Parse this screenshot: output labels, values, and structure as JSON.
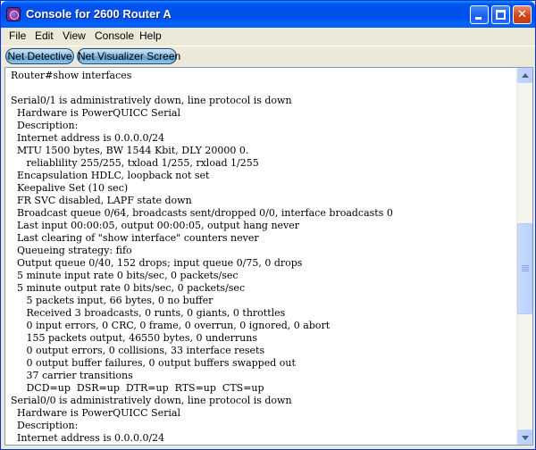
{
  "window": {
    "title": "Console for 2600 Router A",
    "buttons": {
      "minimize": "minimize",
      "maximize": "maximize",
      "close": "close"
    }
  },
  "menu": [
    "File",
    "Edit",
    "View",
    "Console",
    "Help"
  ],
  "toolbar": {
    "net_detective": "Net Detective",
    "net_visualizer": "Net Visualizer Screen"
  },
  "console": {
    "scroll_position": 0.55,
    "lines": [
      "Router#show interfaces",
      "",
      "Serial0/1 is administratively down, line protocol is down",
      "  Hardware is PowerQUICC Serial",
      "  Description:",
      "  Internet address is 0.0.0.0/24",
      "  MTU 1500 bytes, BW 1544 Kbit, DLY 20000 0.",
      "     reliablility 255/255, txload 1/255, rxload 1/255",
      "  Encapsulation HDLC, loopback not set",
      "  Keepalive Set (10 sec)",
      "  FR SVC disabled, LAPF state down",
      "  Broadcast queue 0/64, broadcasts sent/dropped 0/0, interface broadcasts 0",
      "  Last input 00:00:05, output 00:00:05, output hang never",
      "  Last clearing of \"show interface\" counters never",
      "  Queueing strategy: fifo",
      "  Output queue 0/40, 152 drops; input queue 0/75, 0 drops",
      "  5 minute input rate 0 bits/sec, 0 packets/sec",
      "  5 minute output rate 0 bits/sec, 0 packets/sec",
      "     5 packets input, 66 bytes, 0 no buffer",
      "     Received 3 broadcasts, 0 runts, 0 giants, 0 throttles",
      "     0 input errors, 0 CRC, 0 frame, 0 overrun, 0 ignored, 0 abort",
      "     155 packets output, 46550 bytes, 0 underruns",
      "     0 output errors, 0 collisions, 33 interface resets",
      "     0 output buffer failures, 0 output buffers swapped out",
      "     37 carrier transitions",
      "     DCD=up  DSR=up  DTR=up  RTS=up  CTS=up",
      "Serial0/0 is administratively down, line protocol is down",
      "  Hardware is PowerQUICC Serial",
      "  Description:",
      "  Internet address is 0.0.0.0/24"
    ]
  }
}
